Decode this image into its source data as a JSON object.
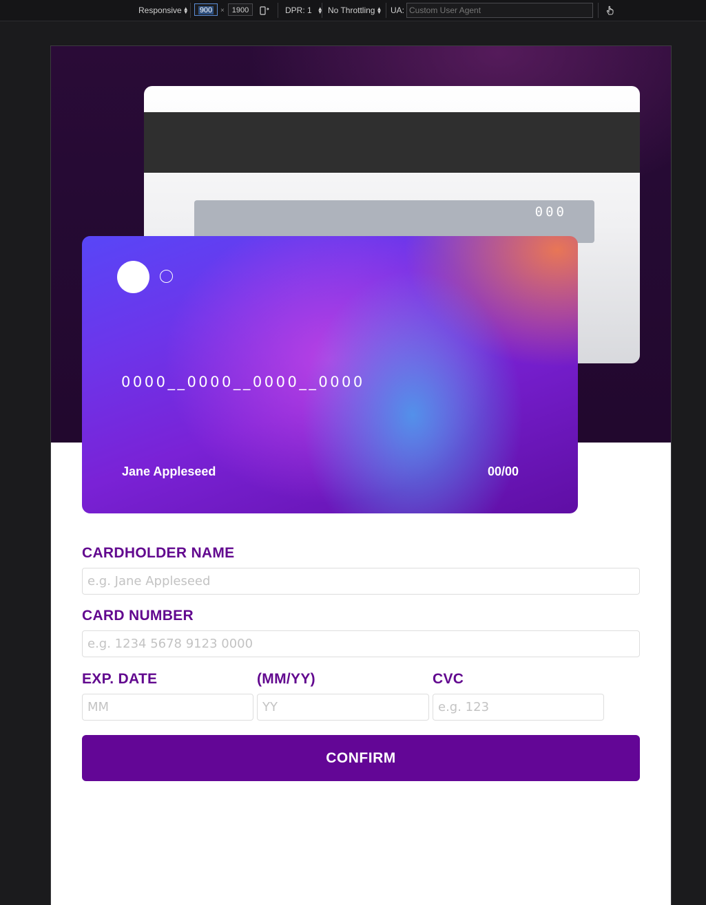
{
  "toolbar": {
    "device": "Responsive",
    "width": "900",
    "height": "1900",
    "times": "×",
    "dpr": "DPR: 1",
    "throttling": "No Throttling",
    "ua_label": "UA:",
    "ua_placeholder": "Custom User Agent"
  },
  "card_back": {
    "cvc": "000"
  },
  "card_front": {
    "number": "0000__0000__0000__0000",
    "name": "Jane Appleseed",
    "expiry": "00/00"
  },
  "form": {
    "name_label": "CARDHOLDER NAME",
    "name_placeholder": "e.g. Jane Appleseed",
    "number_label": "CARD NUMBER",
    "number_placeholder": "e.g. 1234 5678 9123 0000",
    "exp_label": "EXP. DATE",
    "exp_format_label": "(MM/YY)",
    "cvc_label": "CVC",
    "mm_placeholder": "MM",
    "yy_placeholder": "YY",
    "cvc_placeholder": "e.g. 123",
    "confirm_label": "CONFIRM"
  },
  "colors": {
    "accent": "#630696",
    "label": "#62088f",
    "hero_bg": "#250a33"
  }
}
